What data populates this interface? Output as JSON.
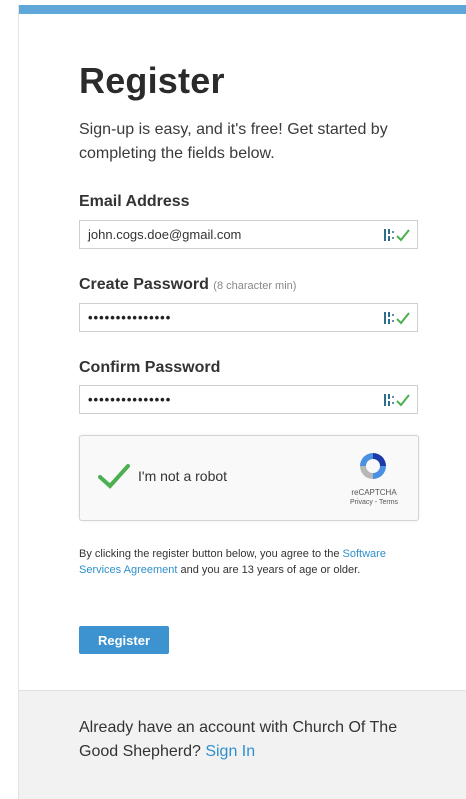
{
  "header": {
    "title": "Register"
  },
  "intro": "Sign-up is easy, and it's free! Get started by completing the fields below.",
  "fields": {
    "email": {
      "label": "Email Address",
      "value": "john.cogs.doe@gmail.com"
    },
    "password": {
      "label": "Create Password",
      "hint": "(8 character min)",
      "value": "•••••••••••••••"
    },
    "confirm": {
      "label": "Confirm Password",
      "value": "•••••••••••••••"
    }
  },
  "captcha": {
    "label": "I'm not a robot",
    "brand": "reCAPTCHA",
    "privacy": "Privacy",
    "separator": " - ",
    "terms": "Terms",
    "checked": true
  },
  "agreement": {
    "before": "By clicking the register button below, you agree to the ",
    "link": "Software Services Agreement",
    "after": " and you are 13 years of age or older."
  },
  "register_button": "Register",
  "signin": {
    "text": "Already have an account with Church Of The Good Shepherd? ",
    "link": "Sign In"
  },
  "colors": {
    "accent_bar": "#5ea7d8",
    "link": "#2f8fcc",
    "button": "#3c93cf",
    "check": "#4caf50"
  },
  "icons": [
    "password-manager-icon",
    "checkmark-icon",
    "recaptcha-logo-icon"
  ]
}
